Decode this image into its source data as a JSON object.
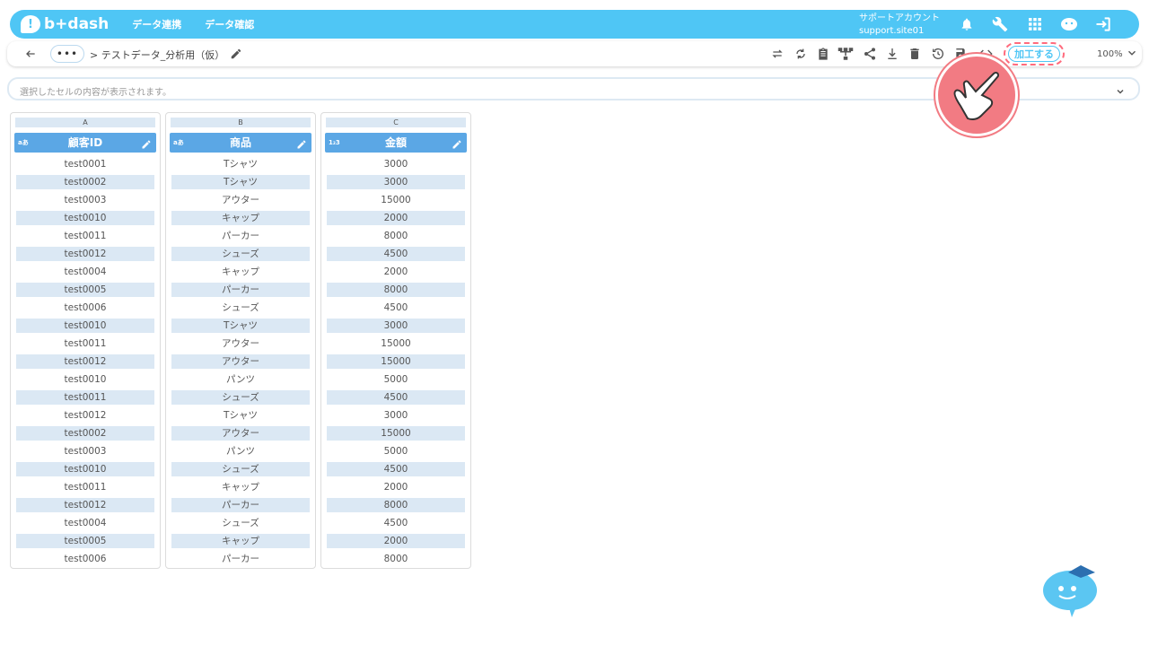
{
  "header": {
    "logo_text": "b+dash",
    "nav": [
      "データ連携",
      "データ確認"
    ],
    "account_line1": "サポートアカウント",
    "account_line2": "support.site01",
    "icons": [
      "bell-icon",
      "wrench-icon",
      "apps-grid-icon",
      "mascot-icon",
      "logout-icon"
    ]
  },
  "toolbar": {
    "more_label": "•••",
    "breadcrumb": "> テストデータ_分析用（仮）",
    "tools": [
      "repeat-icon",
      "sync-icon",
      "clipboard-icon",
      "tree-icon",
      "share-icon",
      "download-icon",
      "trash-icon",
      "history-icon",
      "save-icon",
      "code-icon"
    ],
    "process_label": "加工する",
    "zoom": "100%"
  },
  "cellbar": {
    "placeholder": "選択したセルの内容が表示されます。"
  },
  "columns": [
    {
      "letter": "A",
      "type": "aあ",
      "name": "顧客ID",
      "cells": [
        "test0001",
        "test0002",
        "test0003",
        "test0010",
        "test0011",
        "test0012",
        "test0004",
        "test0005",
        "test0006",
        "test0010",
        "test0011",
        "test0012",
        "test0010",
        "test0011",
        "test0012",
        "test0002",
        "test0003",
        "test0010",
        "test0011",
        "test0012",
        "test0004",
        "test0005",
        "test0006"
      ]
    },
    {
      "letter": "B",
      "type": "aあ",
      "name": "商品",
      "cells": [
        "Tシャツ",
        "Tシャツ",
        "アウター",
        "キャップ",
        "パーカー",
        "シューズ",
        "キャップ",
        "パーカー",
        "シューズ",
        "Tシャツ",
        "アウター",
        "アウター",
        "パンツ",
        "シューズ",
        "Tシャツ",
        "アウター",
        "パンツ",
        "シューズ",
        "キャップ",
        "パーカー",
        "シューズ",
        "キャップ",
        "パーカー"
      ]
    },
    {
      "letter": "C",
      "type": "1₂3",
      "name": "金額",
      "cells": [
        "3000",
        "3000",
        "15000",
        "2000",
        "8000",
        "4500",
        "2000",
        "8000",
        "4500",
        "3000",
        "15000",
        "15000",
        "5000",
        "4500",
        "3000",
        "15000",
        "5000",
        "4500",
        "2000",
        "8000",
        "4500",
        "2000",
        "8000"
      ]
    }
  ],
  "colors": {
    "brand": "#4fc6f5",
    "column_header": "#5ba7e5",
    "row_alt": "#dbe8f4",
    "highlight": "#ff6b7d"
  }
}
